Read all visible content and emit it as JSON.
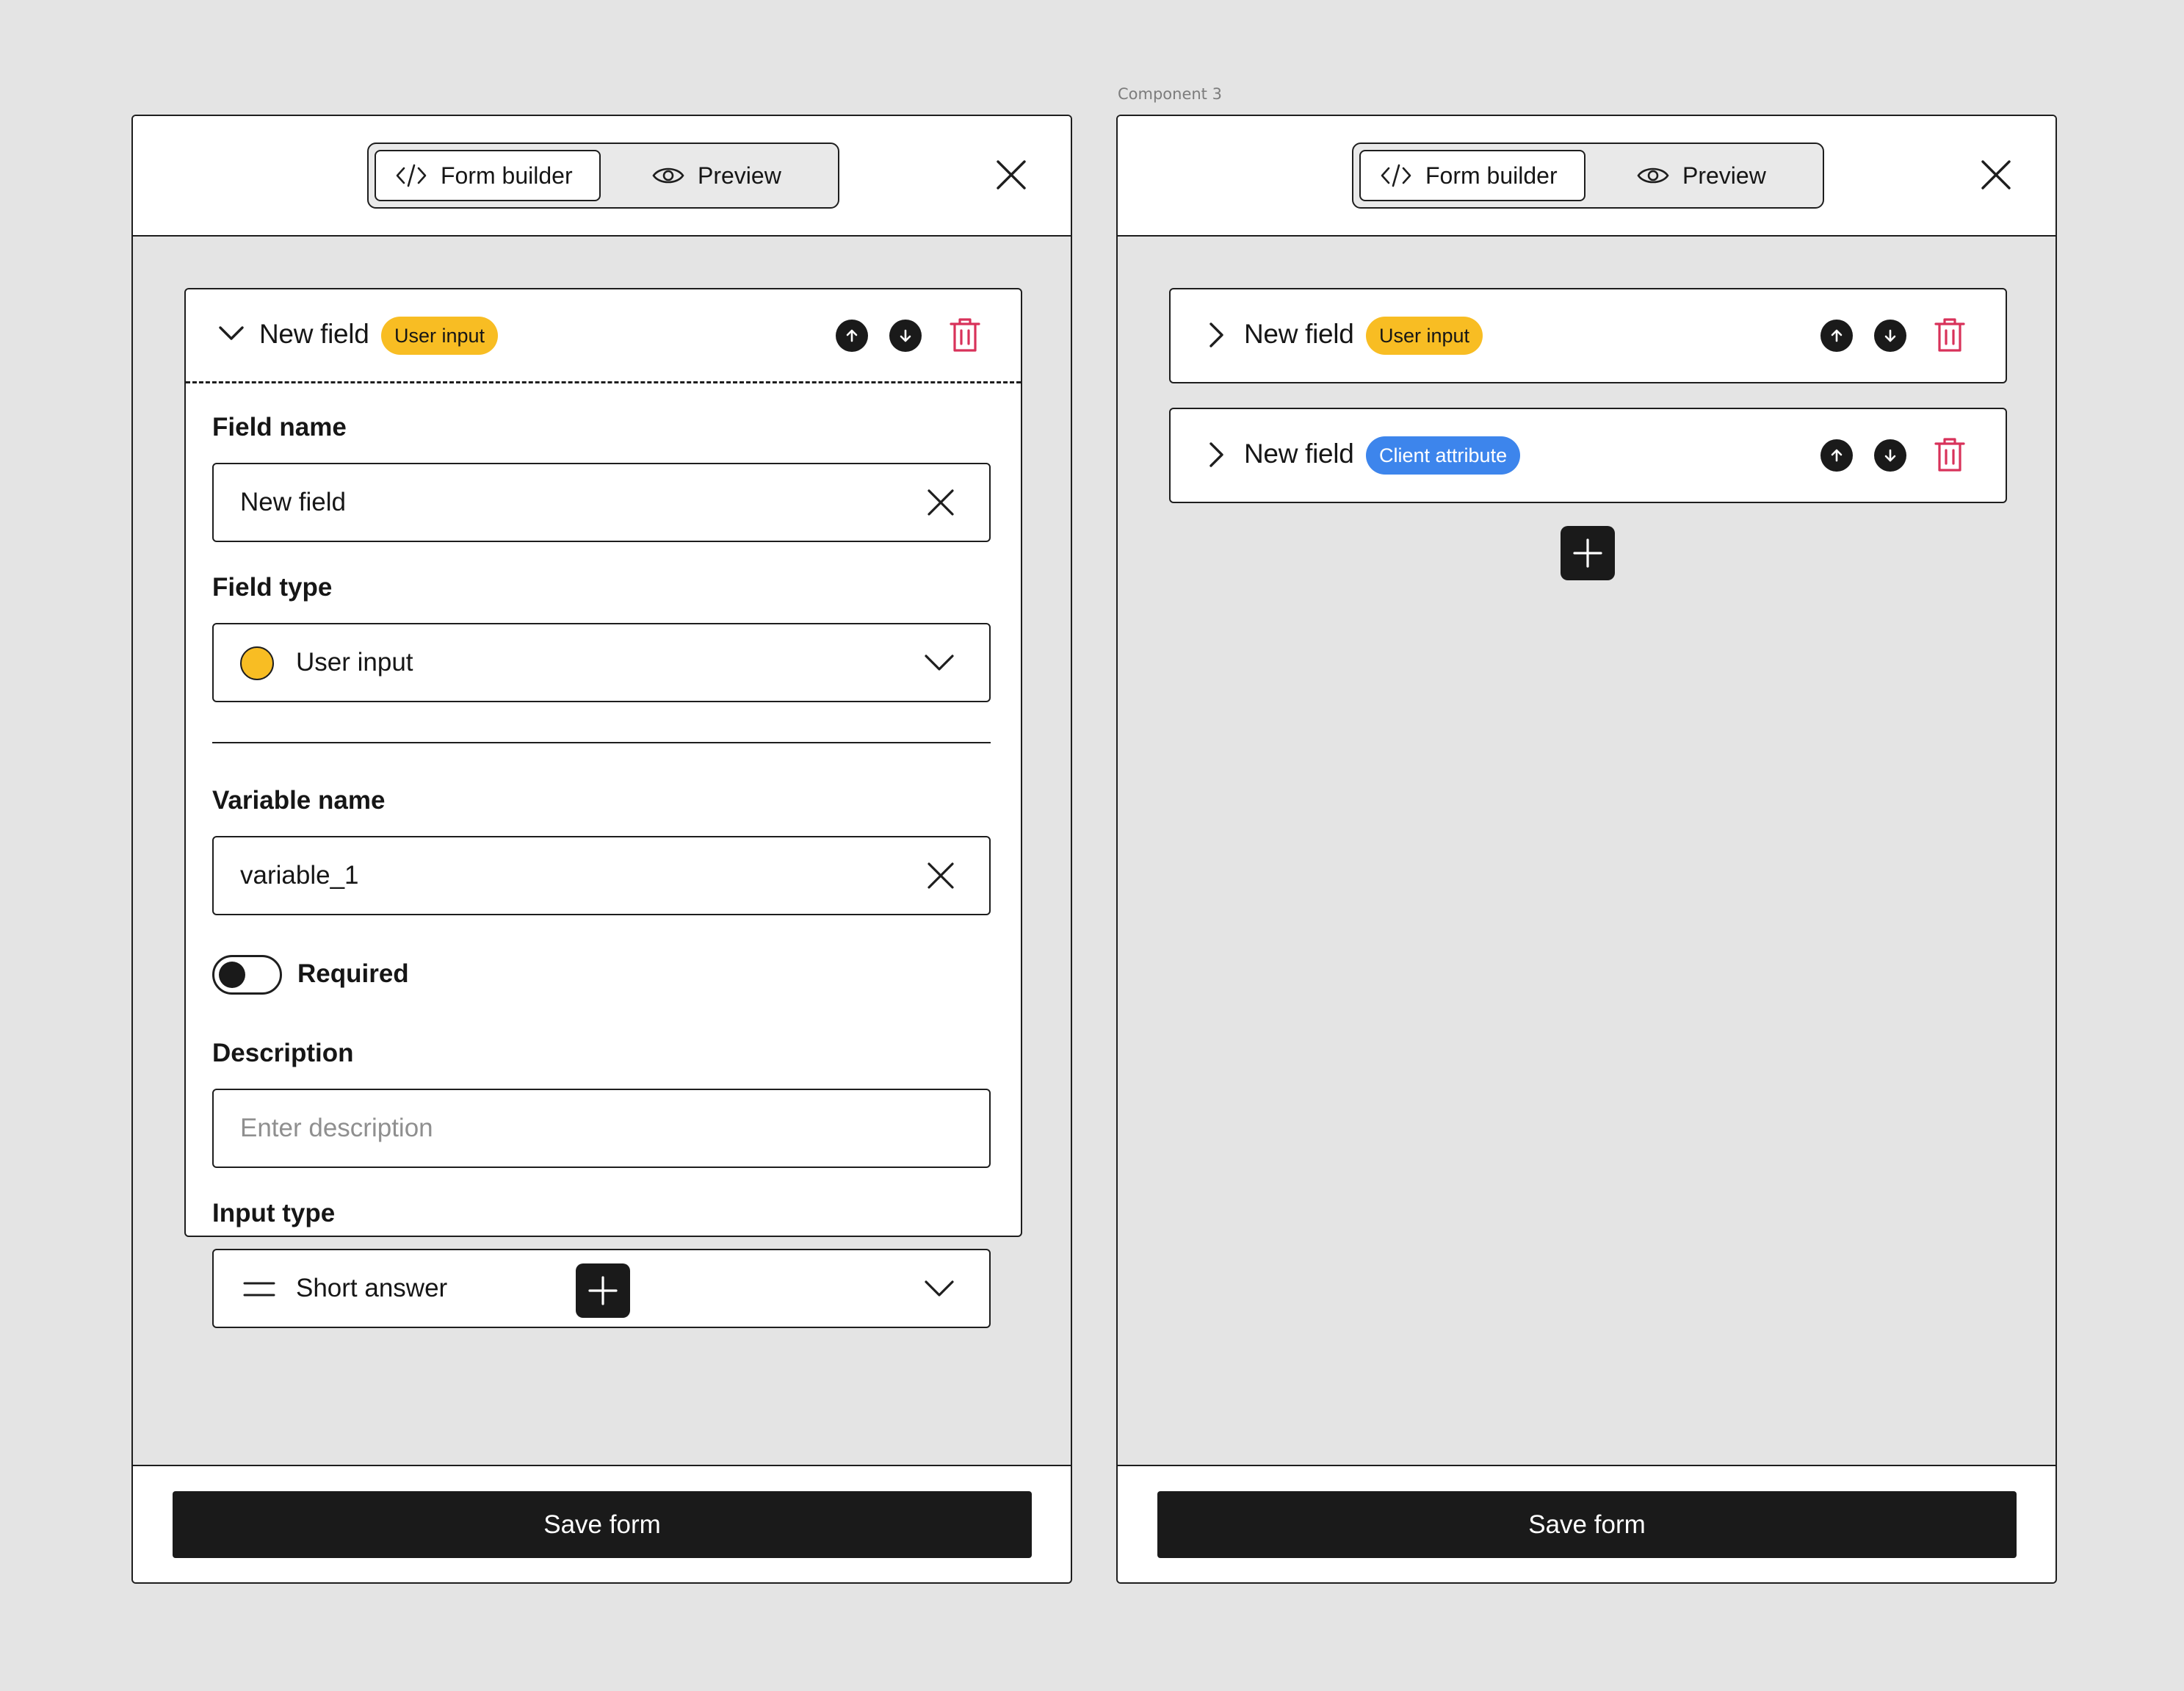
{
  "canvas": {
    "component_label": "Component 3"
  },
  "left_panel": {
    "tabs": {
      "form_builder": "Form builder",
      "preview": "Preview"
    },
    "field": {
      "title": "New field",
      "badge": "User input",
      "field_name_label": "Field name",
      "field_name_value": "New field",
      "field_type_label": "Field type",
      "field_type_value": "User input",
      "variable_name_label": "Variable name",
      "variable_name_value": "variable_1",
      "required_label": "Required",
      "required_on": false,
      "description_label": "Description",
      "description_placeholder": "Enter description",
      "input_type_label": "Input type",
      "input_type_value": "Short answer"
    },
    "save_label": "Save form"
  },
  "right_panel": {
    "tabs": {
      "form_builder": "Form builder",
      "preview": "Preview"
    },
    "fields": [
      {
        "title": "New field",
        "badge": "User input",
        "badge_color": "#f8bd23"
      },
      {
        "title": "New field",
        "badge": "Client attribute",
        "badge_color": "#3d85ec"
      }
    ],
    "save_label": "Save form"
  },
  "colors": {
    "accent_yellow": "#f8bd23",
    "accent_blue": "#3d85ec",
    "danger": "#d8325a",
    "dark": "#1a1a1a"
  }
}
